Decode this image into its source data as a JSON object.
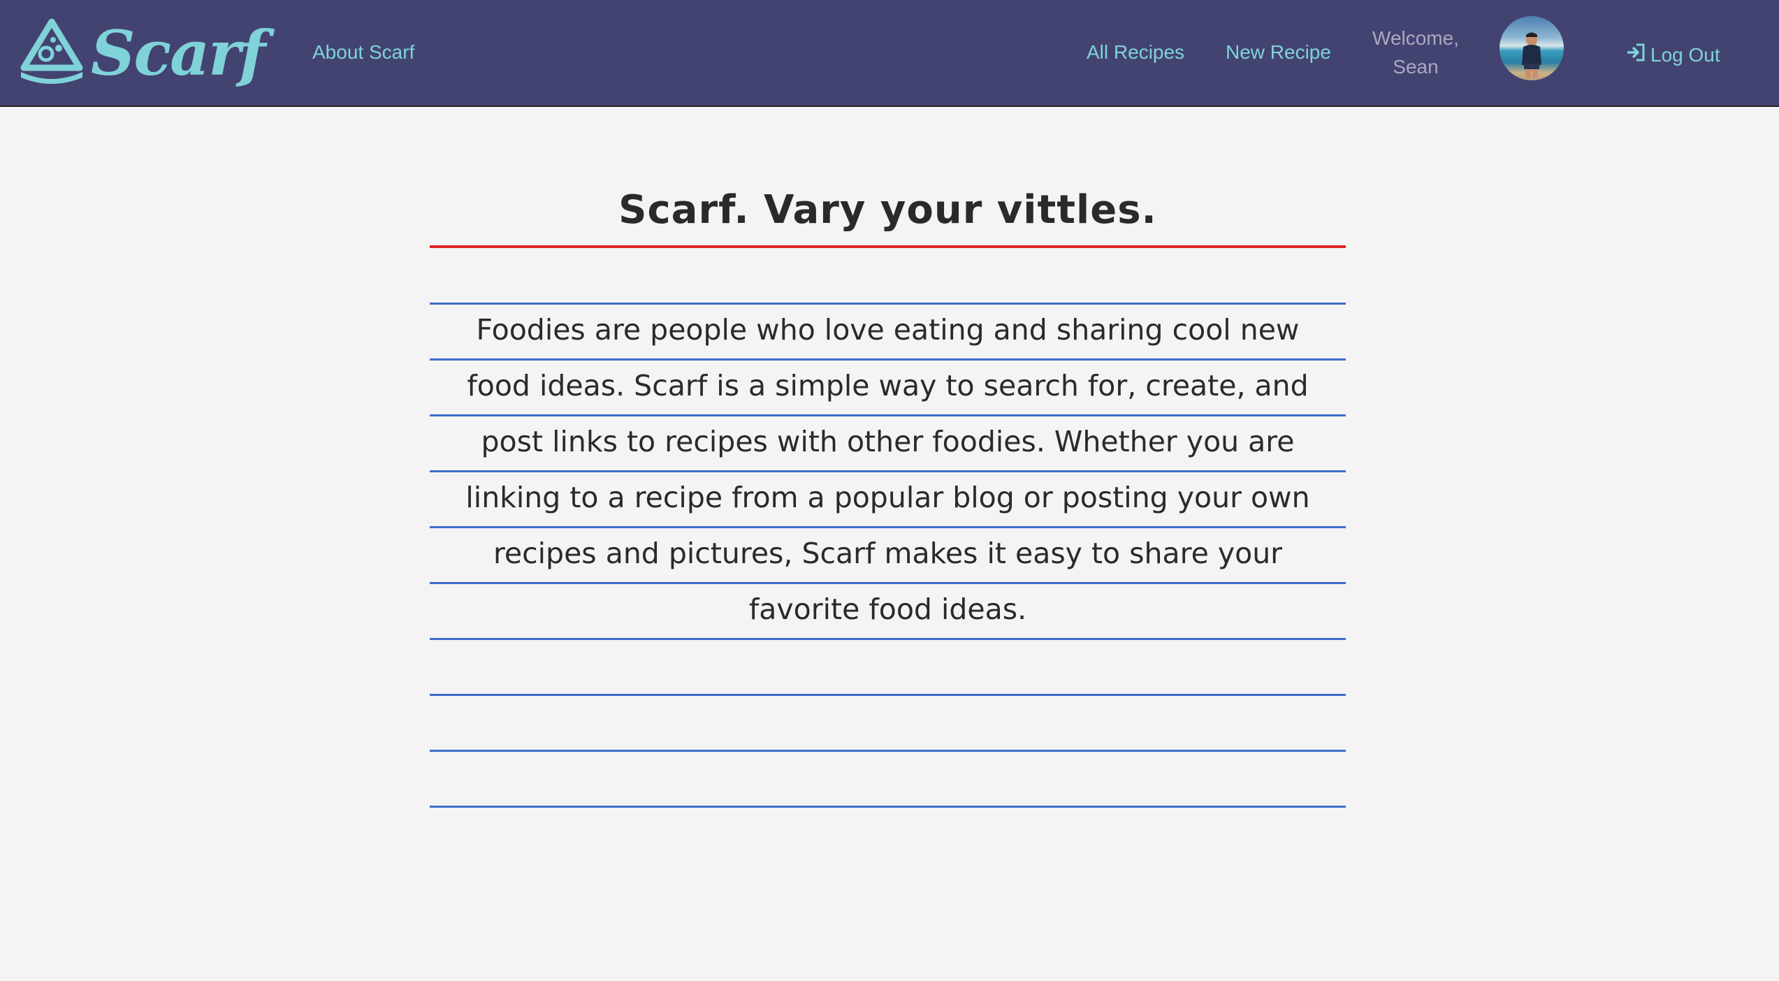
{
  "colors": {
    "nav_bg": "#434372",
    "accent": "#7fd3d8",
    "page_bg": "#f4f4f4",
    "margin_red": "#e0262b",
    "rule_blue": "#3d6ec9"
  },
  "nav": {
    "brand": "Scarf",
    "brand_icon": "pizza-slice-logo-icon",
    "about": "About Scarf",
    "all_recipes": "All Recipes",
    "new_recipe": "New Recipe",
    "welcome_line1": "Welcome,",
    "welcome_line2": "Sean",
    "avatar_icon": "user-avatar",
    "logout": "Log Out",
    "logout_icon": "sign-in-icon"
  },
  "main": {
    "title": "Scarf. Vary your vittles.",
    "description": "Foodies are people who love eating and sharing cool new food ideas. Scarf is a simple way to search for, create, and post links to recipes with other foodies. Whether you are linking to a recipe from a popular blog or posting your own recipes and pictures, Scarf makes it easy to share your favorite food ideas."
  }
}
